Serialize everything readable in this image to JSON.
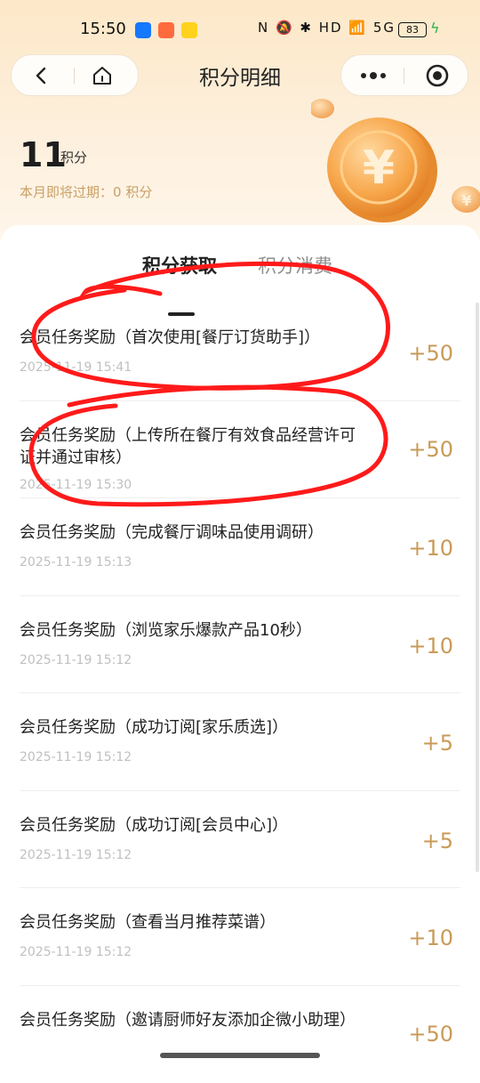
{
  "status_bar": {
    "time": "15:50",
    "icons": "N 🔕 ✱ HD 📶 5G",
    "battery": "83",
    "app_colors": [
      "#1677ff",
      "#ff6a3d",
      "#ffd21e"
    ]
  },
  "nav": {
    "title": "积分明细",
    "back_icon": "chevron-left-icon",
    "home_icon": "home-icon",
    "more_icon": "more-icon",
    "close_icon": "target-icon"
  },
  "points": {
    "value": "11",
    "unit": "积分",
    "expire_label": "本月即将过期：",
    "expire_value": "0 积分"
  },
  "tabs": {
    "earn": "积分获取",
    "spend": "积分消费"
  },
  "records": [
    {
      "title": "会员任务奖励（首次使用[餐厅订货助手]）",
      "date": "2025-11-19 15:41",
      "amount": "+50"
    },
    {
      "title": "会员任务奖励（上传所在餐厅有效食品经营许可证并通过审核）",
      "date": "2025-11-19 15:30",
      "amount": "+50"
    },
    {
      "title": "会员任务奖励（完成餐厅调味品使用调研）",
      "date": "2025-11-19 15:13",
      "amount": "+10"
    },
    {
      "title": "会员任务奖励（浏览家乐爆款产品10秒）",
      "date": "2025-11-19 15:12",
      "amount": "+10"
    },
    {
      "title": "会员任务奖励（成功订阅[家乐质选]）",
      "date": "2025-11-19 15:12",
      "amount": "+5"
    },
    {
      "title": "会员任务奖励（成功订阅[会员中心]）",
      "date": "2025-11-19 15:12",
      "amount": "+5"
    },
    {
      "title": "会员任务奖励（查看当月推荐菜谱）",
      "date": "2025-11-19 15:12",
      "amount": "+10"
    },
    {
      "title": "会员任务奖励（邀请厨师好友添加企微小助理）",
      "date": "",
      "amount": "+50"
    }
  ],
  "colors": {
    "accent_gold": "#c99a57",
    "annotation_red": "#ff1a1a"
  }
}
